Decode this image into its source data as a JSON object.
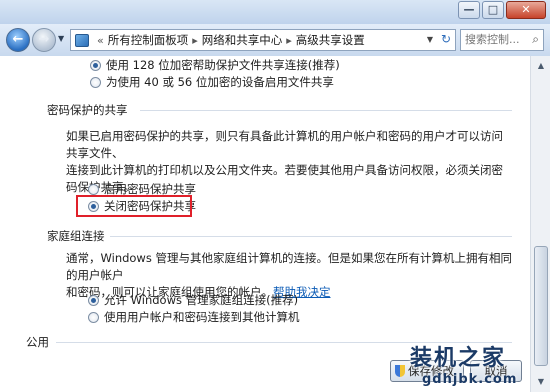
{
  "window": {
    "minimize_glyph": "—",
    "maximize_glyph": "□",
    "close_glyph": "✕"
  },
  "nav": {
    "back_icon": "←",
    "forward_icon": "→",
    "dropdown_icon": "▼",
    "breadcrumb_prefix": "«",
    "breadcrumbs": [
      "所有控制面板项",
      "网络和共享中心",
      "高级共享设置"
    ],
    "chevron": "▸",
    "refresh_icon": "↻",
    "search_placeholder": "搜索控制...",
    "search_icon": "⌕"
  },
  "sections": {
    "encryption": {
      "option_128": "使用 128 位加密帮助保护文件共享连接(推荐)",
      "option_40_56": "为使用 40 或 56 位加密的设备启用文件共享",
      "selected": "option_128"
    },
    "password": {
      "title": "密码保护的共享",
      "description_line1": "如果已启用密码保护的共享，则只有具备此计算机的用户帐户和密码的用户才可以访问共享文件、",
      "description_line2": "连接到此计算机的打印机以及公用文件夹。若要使其他用户具备访问权限，必须关闭密码保护共享。",
      "option_on": "启用密码保护共享",
      "option_off": "关闭密码保护共享",
      "selected": "option_off"
    },
    "homegroup": {
      "title": "家庭组连接",
      "description_line1": "通常，Windows 管理与其他家庭组计算机的连接。但是如果您在所有计算机上拥有相同的用户帐户",
      "description_line2_prefix": "和密码，则可以让家庭组使用您的帐户。",
      "help_link": "帮助我决定",
      "option_allow": "允许 Windows 管理家庭组连接(推荐)",
      "option_user": "使用用户帐户和密码连接到其他计算机",
      "selected": "option_allow"
    },
    "public": {
      "title": "公用"
    }
  },
  "buttons": {
    "save": "保存修改",
    "cancel": "取消"
  },
  "watermark": {
    "big": "装机之家",
    "small": "gdhjbk.com"
  },
  "colors": {
    "highlight_border": "#e0202a",
    "link": "#0b5bb5"
  }
}
